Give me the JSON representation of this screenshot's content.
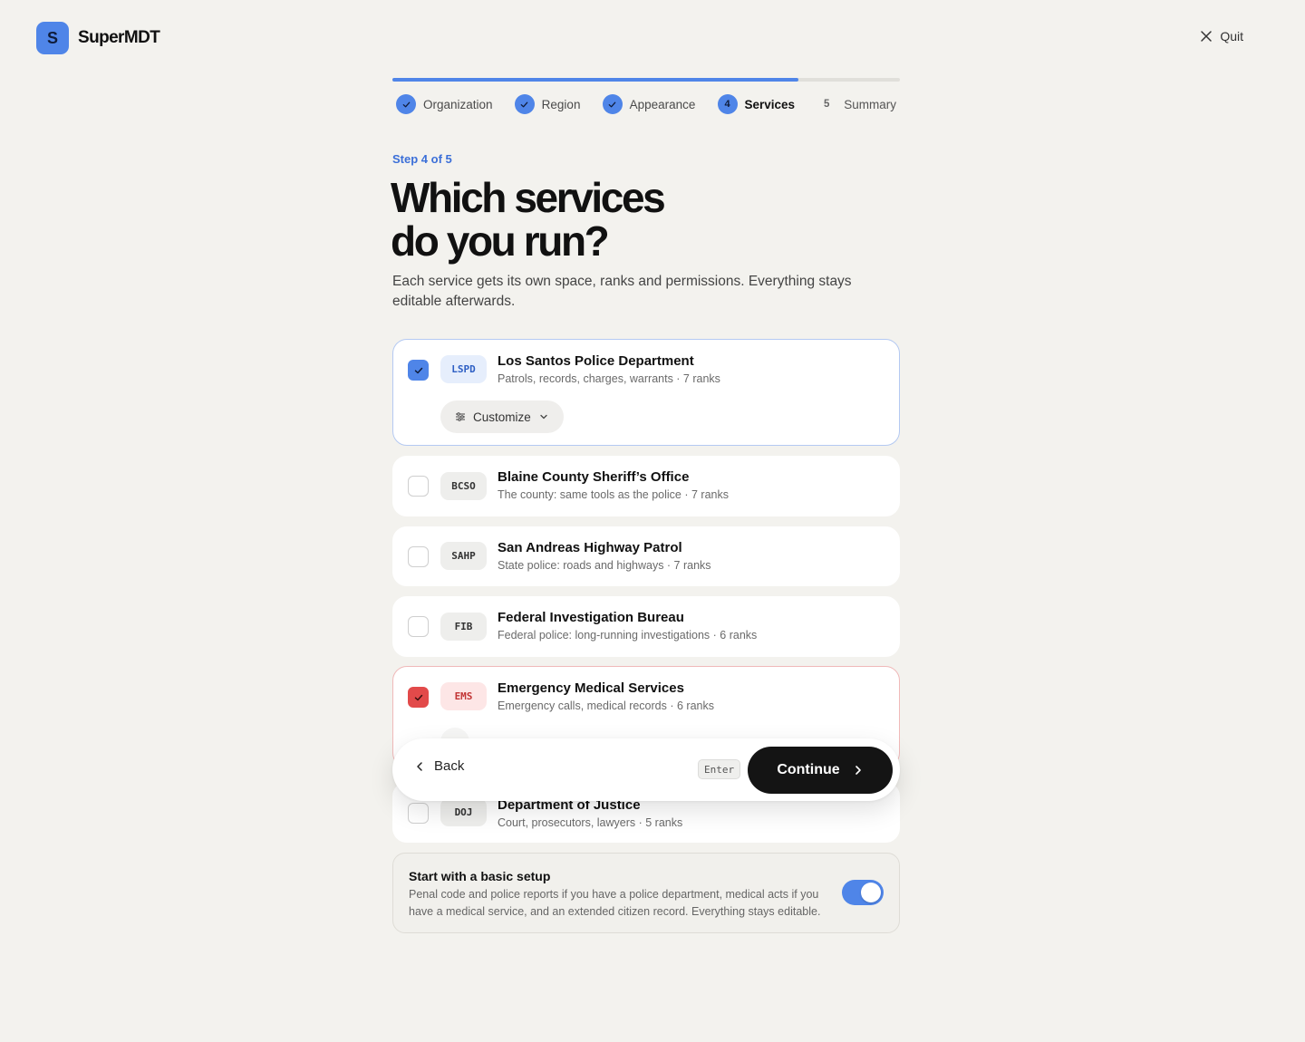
{
  "brand": {
    "logo_letter": "S",
    "name": "SuperMDT"
  },
  "header": {
    "quit_label": "Quit"
  },
  "stepper": {
    "progress": 0.8,
    "steps": [
      {
        "label": "Organization",
        "state": "done"
      },
      {
        "label": "Region",
        "state": "done"
      },
      {
        "label": "Appearance",
        "state": "done"
      },
      {
        "number": "4",
        "label": "Services",
        "state": "current"
      },
      {
        "number": "5",
        "label": "Summary",
        "state": "pending"
      }
    ]
  },
  "intro": {
    "step_of": "Step 4 of 5",
    "title_line1": "Which services",
    "title_line2": "do you run?",
    "subtitle": "Each service gets its own space, ranks and permissions. Everything stays editable afterwards."
  },
  "services": [
    {
      "code": "LSPD",
      "name": "Los Santos Police Department",
      "description": "Patrols, records, charges, warrants · 7 ranks",
      "checked": true,
      "accent": "#4f85e8",
      "customize_label": "Customize"
    },
    {
      "code": "BCSO",
      "name": "Blaine County Sheriff’s Office",
      "description": "The county: same tools as the police · 7 ranks",
      "checked": false
    },
    {
      "code": "SAHP",
      "name": "San Andreas Highway Patrol",
      "description": "State police: roads and highways · 7 ranks",
      "checked": false
    },
    {
      "code": "FIB",
      "name": "Federal Investigation Bureau",
      "description": "Federal police: long-running investigations · 6 ranks",
      "checked": false
    },
    {
      "code": "EMS",
      "name": "Emergency Medical Services",
      "description": "Emergency calls, medical records · 6 ranks",
      "checked": true,
      "accent": "#e24a4a"
    },
    {
      "code": "DOJ",
      "name": "Department of Justice",
      "description": "Court, prosecutors, lawyers · 5 ranks",
      "checked": false
    }
  ],
  "actions": {
    "back_label": "Back",
    "shortcut_key": "Enter",
    "continue_label": "Continue"
  },
  "basic_setup": {
    "title": "Start with a basic setup",
    "description": "Penal code and police reports if you have a police department, medical acts if you have a medical service, and an extended citizen record. Everything stays editable.",
    "enabled": true
  },
  "colors": {
    "accent": "#4f85e8",
    "ems": "#e24a4a",
    "background": "#f3f2ee"
  }
}
